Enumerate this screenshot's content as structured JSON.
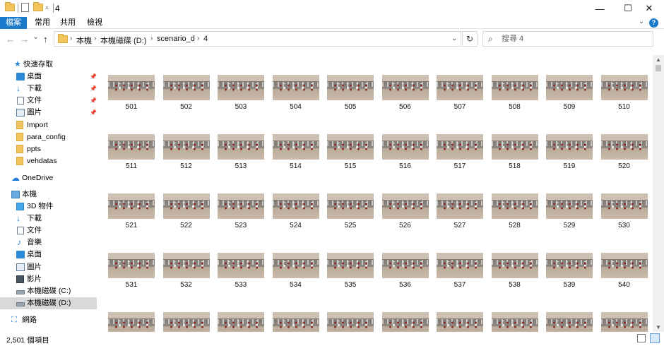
{
  "window": {
    "title": "4",
    "controls": {
      "minimize": "—",
      "maximize": "☐",
      "close": "✕"
    }
  },
  "ribbon": {
    "tabs": [
      "檔案",
      "常用",
      "共用",
      "檢視"
    ],
    "expand_icon": "chevron-down-icon",
    "help_label": "?"
  },
  "navigation": {
    "back": "←",
    "forward": "→",
    "recent": "⌄",
    "up": "↑"
  },
  "address": {
    "crumbs": [
      "本機",
      "本機磁碟 (D:)",
      "scenario_d",
      "4"
    ],
    "refresh": "↻"
  },
  "search": {
    "placeholder": "搜尋 4"
  },
  "sidebar": {
    "items": [
      {
        "label": "快速存取",
        "icon": "star-icon",
        "pinned": false
      },
      {
        "label": "桌面",
        "icon": "desktop-icon",
        "pinned": true
      },
      {
        "label": "下載",
        "icon": "download-icon",
        "pinned": true
      },
      {
        "label": "文件",
        "icon": "document-icon",
        "pinned": true
      },
      {
        "label": "圖片",
        "icon": "pictures-icon",
        "pinned": true
      },
      {
        "label": "Import",
        "icon": "folder-icon",
        "pinned": false
      },
      {
        "label": "para_config",
        "icon": "folder-icon",
        "pinned": false
      },
      {
        "label": "ppts",
        "icon": "folder-icon",
        "pinned": false
      },
      {
        "label": "vehdatas",
        "icon": "folder-icon",
        "pinned": false
      },
      {
        "label": "OneDrive",
        "icon": "onedrive-icon",
        "pinned": false
      },
      {
        "label": "本機",
        "icon": "this-pc-icon",
        "pinned": false
      },
      {
        "label": "3D 物件",
        "icon": "3d-objects-icon",
        "pinned": false
      },
      {
        "label": "下載",
        "icon": "download-icon",
        "pinned": false
      },
      {
        "label": "文件",
        "icon": "document-icon",
        "pinned": false
      },
      {
        "label": "音樂",
        "icon": "music-icon",
        "pinned": false
      },
      {
        "label": "桌面",
        "icon": "desktop-icon",
        "pinned": false
      },
      {
        "label": "圖片",
        "icon": "pictures-icon",
        "pinned": false
      },
      {
        "label": "影片",
        "icon": "videos-icon",
        "pinned": false
      },
      {
        "label": "本機磁碟 (C:)",
        "icon": "drive-icon",
        "pinned": false
      },
      {
        "label": "本機磁碟 (D:)",
        "icon": "drive-icon",
        "pinned": false,
        "selected": true
      },
      {
        "label": "網路",
        "icon": "network-icon",
        "pinned": false
      }
    ]
  },
  "files": {
    "labels": [
      "501",
      "502",
      "503",
      "504",
      "505",
      "506",
      "507",
      "508",
      "509",
      "510",
      "511",
      "512",
      "513",
      "514",
      "515",
      "516",
      "517",
      "518",
      "519",
      "520",
      "521",
      "522",
      "523",
      "524",
      "525",
      "526",
      "527",
      "528",
      "529",
      "530",
      "531",
      "532",
      "533",
      "534",
      "535",
      "536",
      "537",
      "538",
      "539",
      "540",
      "",
      "",
      "",
      "",
      "",
      "",
      "",
      "",
      "",
      ""
    ]
  },
  "status": {
    "item_count": "2,501 個項目"
  },
  "colors": {
    "accent": "#1979ca",
    "selected_bg": "#d9d9d9",
    "folder": "#f2c55c"
  }
}
